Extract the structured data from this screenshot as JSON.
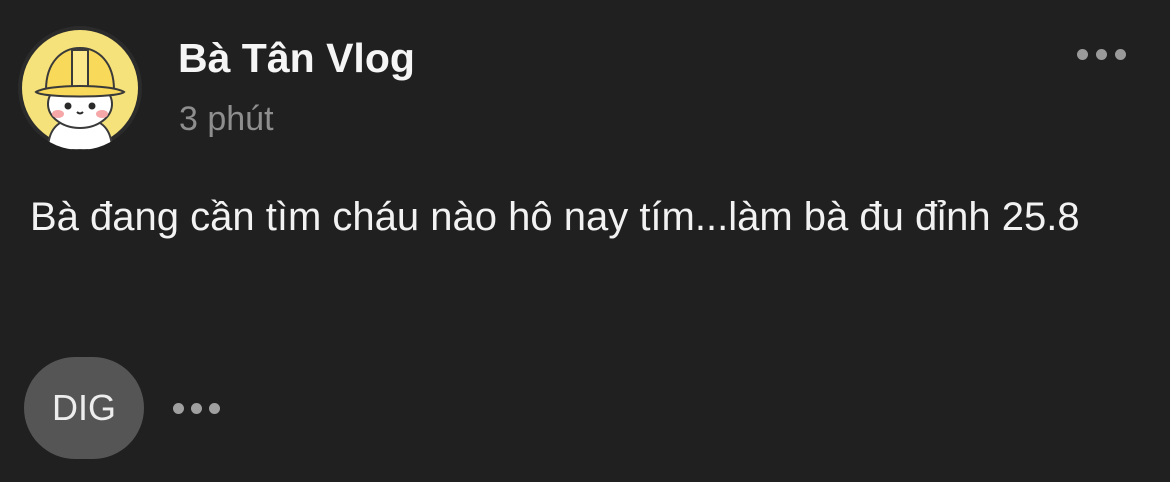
{
  "post": {
    "author": {
      "name": "Bà Tân Vlog",
      "avatar_icon": "hardhat-character-avatar-icon"
    },
    "timestamp": "3 phút",
    "text": "Bà đang cần tìm cháu nào hô nay tím...làm bà đu đỉnh 25.8",
    "reaction_label": "DIG",
    "menu_icon": "more-horizontal-icon"
  },
  "colors": {
    "background": "#202020",
    "text_primary": "#f2f2f2",
    "text_secondary": "#8e8e8e",
    "pill_background": "#555555",
    "avatar_yellow": "#f7e37a"
  }
}
